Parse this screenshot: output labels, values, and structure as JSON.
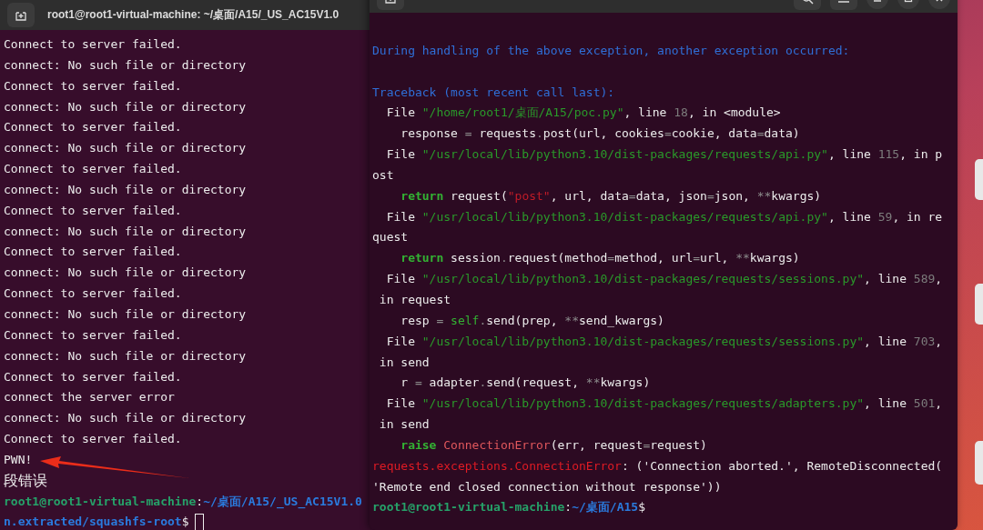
{
  "left_terminal": {
    "title": "root1@root1-virtual-machine: ~/桌面/A15/_US_AC15V1.0",
    "lines": [
      {
        "kind": "text",
        "segments": [
          {
            "kind": "plain",
            "text": "Connect to server failed."
          }
        ]
      },
      {
        "kind": "text",
        "segments": [
          {
            "kind": "plain",
            "text": "connect: No such file or directory"
          }
        ]
      },
      {
        "kind": "text",
        "segments": [
          {
            "kind": "plain",
            "text": "Connect to server failed."
          }
        ]
      },
      {
        "kind": "text",
        "segments": [
          {
            "kind": "plain",
            "text": "connect: No such file or directory"
          }
        ]
      },
      {
        "kind": "text",
        "segments": [
          {
            "kind": "plain",
            "text": "Connect to server failed."
          }
        ]
      },
      {
        "kind": "text",
        "segments": [
          {
            "kind": "plain",
            "text": "connect: No such file or directory"
          }
        ]
      },
      {
        "kind": "text",
        "segments": [
          {
            "kind": "plain",
            "text": "Connect to server failed."
          }
        ]
      },
      {
        "kind": "text",
        "segments": [
          {
            "kind": "plain",
            "text": "connect: No such file or directory"
          }
        ]
      },
      {
        "kind": "text",
        "segments": [
          {
            "kind": "plain",
            "text": "Connect to server failed."
          }
        ]
      },
      {
        "kind": "text",
        "segments": [
          {
            "kind": "plain",
            "text": "connect: No such file or directory"
          }
        ]
      },
      {
        "kind": "text",
        "segments": [
          {
            "kind": "plain",
            "text": "Connect to server failed."
          }
        ]
      },
      {
        "kind": "text",
        "segments": [
          {
            "kind": "plain",
            "text": "connect: No such file or directory"
          }
        ]
      },
      {
        "kind": "text",
        "segments": [
          {
            "kind": "plain",
            "text": "Connect to server failed."
          }
        ]
      },
      {
        "kind": "text",
        "segments": [
          {
            "kind": "plain",
            "text": "connect: No such file or directory"
          }
        ]
      },
      {
        "kind": "text",
        "segments": [
          {
            "kind": "plain",
            "text": "Connect to server failed."
          }
        ]
      },
      {
        "kind": "text",
        "segments": [
          {
            "kind": "plain",
            "text": "connect: No such file or directory"
          }
        ]
      },
      {
        "kind": "text",
        "segments": [
          {
            "kind": "plain",
            "text": "Connect to server failed."
          }
        ]
      },
      {
        "kind": "text",
        "segments": [
          {
            "kind": "plain",
            "text": "connect the server error"
          }
        ]
      },
      {
        "kind": "text",
        "segments": [
          {
            "kind": "plain",
            "text": "connect: No such file or directory"
          }
        ]
      },
      {
        "kind": "text",
        "segments": [
          {
            "kind": "plain",
            "text": "Connect to server failed."
          }
        ]
      },
      {
        "kind": "text",
        "segments": [
          {
            "kind": "plain",
            "text": "PWN!"
          }
        ]
      },
      {
        "kind": "cjk",
        "segments": [
          {
            "kind": "plain",
            "text": "段错误"
          }
        ]
      },
      {
        "kind": "prompt",
        "segments": [
          {
            "kind": "prompt_user",
            "text": "root1@root1-virtual-machine"
          },
          {
            "kind": "plain",
            "text": ":"
          },
          {
            "kind": "prompt_path",
            "text": "~/桌面/A15/_US_AC15V1.0"
          }
        ]
      },
      {
        "kind": "prompt",
        "cursor": true,
        "segments": [
          {
            "kind": "prompt_path",
            "text": "n.extracted/squashfs-root"
          },
          {
            "kind": "plain",
            "text": "$"
          }
        ]
      }
    ]
  },
  "right_terminal": {
    "lines": [
      {
        "kind": "blank"
      },
      {
        "kind": "text",
        "segments": [
          {
            "kind": "info",
            "text": "During handling of the above exception, another exception occurred:"
          }
        ]
      },
      {
        "kind": "blank"
      },
      {
        "kind": "text",
        "segments": [
          {
            "kind": "info",
            "text": "Traceback (most recent call last):"
          }
        ]
      },
      {
        "kind": "text",
        "segments": [
          {
            "kind": "plain",
            "text": "  File "
          },
          {
            "kind": "string",
            "text": "\"/home/root1/桌面/A15/poc.py\""
          },
          {
            "kind": "plain",
            "text": ", line "
          },
          {
            "kind": "number",
            "text": "18"
          },
          {
            "kind": "plain",
            "text": ", in <module>"
          }
        ]
      },
      {
        "kind": "text",
        "segments": [
          {
            "kind": "plain",
            "text": "    response "
          },
          {
            "kind": "op",
            "text": "="
          },
          {
            "kind": "plain",
            "text": " requests"
          },
          {
            "kind": "op",
            "text": "."
          },
          {
            "kind": "plain",
            "text": "post(url, cookies"
          },
          {
            "kind": "op",
            "text": "="
          },
          {
            "kind": "plain",
            "text": "cookie, data"
          },
          {
            "kind": "op",
            "text": "="
          },
          {
            "kind": "plain",
            "text": "data)"
          }
        ]
      },
      {
        "kind": "text",
        "segments": [
          {
            "kind": "plain",
            "text": "  File "
          },
          {
            "kind": "string",
            "text": "\"/usr/local/lib/python3.10/dist-packages/requests/api.py\""
          },
          {
            "kind": "plain",
            "text": ", line "
          },
          {
            "kind": "number",
            "text": "115"
          },
          {
            "kind": "plain",
            "text": ", in p"
          }
        ]
      },
      {
        "kind": "text",
        "segments": [
          {
            "kind": "plain",
            "text": "ost"
          }
        ]
      },
      {
        "kind": "text",
        "segments": [
          {
            "kind": "keyword",
            "text": "    return"
          },
          {
            "kind": "plain",
            "text": " request("
          },
          {
            "kind": "literal",
            "text": "\"post\""
          },
          {
            "kind": "plain",
            "text": ", url, data"
          },
          {
            "kind": "op",
            "text": "="
          },
          {
            "kind": "plain",
            "text": "data, json"
          },
          {
            "kind": "op",
            "text": "="
          },
          {
            "kind": "plain",
            "text": "json, "
          },
          {
            "kind": "op",
            "text": "**"
          },
          {
            "kind": "plain",
            "text": "kwargs)"
          }
        ]
      },
      {
        "kind": "text",
        "segments": [
          {
            "kind": "plain",
            "text": "  File "
          },
          {
            "kind": "string",
            "text": "\"/usr/local/lib/python3.10/dist-packages/requests/api.py\""
          },
          {
            "kind": "plain",
            "text": ", line "
          },
          {
            "kind": "number",
            "text": "59"
          },
          {
            "kind": "plain",
            "text": ", in re"
          }
        ]
      },
      {
        "kind": "text",
        "segments": [
          {
            "kind": "plain",
            "text": "quest"
          }
        ]
      },
      {
        "kind": "text",
        "segments": [
          {
            "kind": "keyword",
            "text": "    return"
          },
          {
            "kind": "plain",
            "text": " session"
          },
          {
            "kind": "op",
            "text": "."
          },
          {
            "kind": "plain",
            "text": "request(method"
          },
          {
            "kind": "op",
            "text": "="
          },
          {
            "kind": "plain",
            "text": "method, url"
          },
          {
            "kind": "op",
            "text": "="
          },
          {
            "kind": "plain",
            "text": "url, "
          },
          {
            "kind": "op",
            "text": "**"
          },
          {
            "kind": "plain",
            "text": "kwargs)"
          }
        ]
      },
      {
        "kind": "text",
        "segments": [
          {
            "kind": "plain",
            "text": "  File "
          },
          {
            "kind": "string",
            "text": "\"/usr/local/lib/python3.10/dist-packages/requests/sessions.py\""
          },
          {
            "kind": "plain",
            "text": ", line "
          },
          {
            "kind": "number",
            "text": "589"
          },
          {
            "kind": "plain",
            "text": ","
          }
        ]
      },
      {
        "kind": "text",
        "segments": [
          {
            "kind": "plain",
            "text": " in request"
          }
        ]
      },
      {
        "kind": "text",
        "segments": [
          {
            "kind": "plain",
            "text": "    resp "
          },
          {
            "kind": "op",
            "text": "="
          },
          {
            "kind": "self",
            "text": " self"
          },
          {
            "kind": "op",
            "text": "."
          },
          {
            "kind": "plain",
            "text": "send(prep, "
          },
          {
            "kind": "op",
            "text": "**"
          },
          {
            "kind": "plain",
            "text": "send_kwargs)"
          }
        ]
      },
      {
        "kind": "text",
        "segments": [
          {
            "kind": "plain",
            "text": "  File "
          },
          {
            "kind": "string",
            "text": "\"/usr/local/lib/python3.10/dist-packages/requests/sessions.py\""
          },
          {
            "kind": "plain",
            "text": ", line "
          },
          {
            "kind": "number",
            "text": "703"
          },
          {
            "kind": "plain",
            "text": ","
          }
        ]
      },
      {
        "kind": "text",
        "segments": [
          {
            "kind": "plain",
            "text": " in send"
          }
        ]
      },
      {
        "kind": "text",
        "segments": [
          {
            "kind": "plain",
            "text": "    r "
          },
          {
            "kind": "op",
            "text": "="
          },
          {
            "kind": "plain",
            "text": " adapter"
          },
          {
            "kind": "op",
            "text": "."
          },
          {
            "kind": "plain",
            "text": "send(request, "
          },
          {
            "kind": "op",
            "text": "**"
          },
          {
            "kind": "plain",
            "text": "kwargs)"
          }
        ]
      },
      {
        "kind": "text",
        "segments": [
          {
            "kind": "plain",
            "text": "  File "
          },
          {
            "kind": "string",
            "text": "\"/usr/local/lib/python3.10/dist-packages/requests/adapters.py\""
          },
          {
            "kind": "plain",
            "text": ", line "
          },
          {
            "kind": "number",
            "text": "501"
          },
          {
            "kind": "plain",
            "text": ","
          }
        ]
      },
      {
        "kind": "text",
        "segments": [
          {
            "kind": "plain",
            "text": " in send"
          }
        ]
      },
      {
        "kind": "text",
        "segments": [
          {
            "kind": "keyword",
            "text": "    raise"
          },
          {
            "kind": "exc_name",
            "text": " ConnectionError"
          },
          {
            "kind": "plain",
            "text": "(err, request"
          },
          {
            "kind": "op",
            "text": "="
          },
          {
            "kind": "plain",
            "text": "request)"
          }
        ]
      },
      {
        "kind": "text",
        "segments": [
          {
            "kind": "error",
            "text": "requests.exceptions.ConnectionError"
          },
          {
            "kind": "plain",
            "text": ": ('Connection aborted.', RemoteDisconnected("
          }
        ]
      },
      {
        "kind": "text",
        "segments": [
          {
            "kind": "plain",
            "text": "'Remote end closed connection without response'))"
          }
        ]
      },
      {
        "kind": "prompt",
        "segments": [
          {
            "kind": "prompt_user",
            "text": "root1@root1-virtual-machine"
          },
          {
            "kind": "plain",
            "text": ":"
          },
          {
            "kind": "prompt_path",
            "text": "~/桌面/A15"
          },
          {
            "kind": "plain",
            "text": "$"
          }
        ]
      }
    ]
  }
}
